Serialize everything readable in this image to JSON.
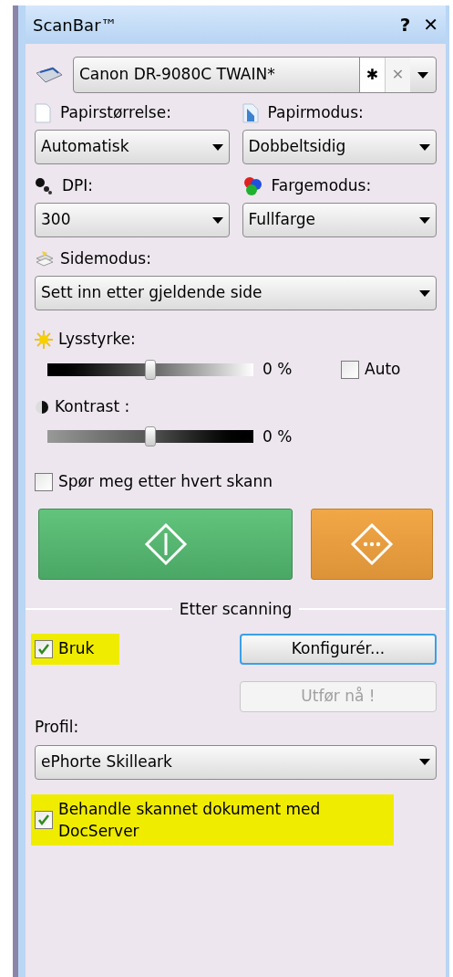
{
  "window": {
    "title": "ScanBar™",
    "help": "?",
    "close": "✕"
  },
  "scanner": {
    "value": "Canon DR-9080C TWAIN*",
    "star": "✱",
    "clear": "✕",
    "clear_disabled": true
  },
  "fields": [
    {
      "label": "Papirstørrelse:",
      "value": "Automatisk"
    },
    {
      "label": "Papirmodus:",
      "value": "Dobbeltsidig"
    },
    {
      "label": "DPI:",
      "value": "300"
    },
    {
      "label": "Fargemodus:",
      "value": "Fullfarge"
    }
  ],
  "side_mode": {
    "label": "Sidemodus:",
    "value": "Sett inn etter gjeldende side"
  },
  "sliders": [
    {
      "kind": "brightness",
      "label": "Lysstyrke:",
      "level": 0.5,
      "reading": "0 %"
    },
    {
      "kind": "contrast",
      "label": "Kontrast :",
      "level": 0.5,
      "reading": "0 %"
    }
  ],
  "auto": {
    "label": "Auto",
    "checked": false
  },
  "ask_each_scan": {
    "label": "Spør meg etter hvert skann",
    "checked": false
  },
  "after_scanning": {
    "title": "Etter scanning",
    "use": {
      "label": "Bruk",
      "checked": true,
      "highlighted": true
    },
    "configure": "Konfigurér...",
    "run_now": {
      "label": "Utfør nå !",
      "disabled": true
    },
    "profile": {
      "label": "Profil:",
      "value": "ePhorte Skilleark"
    },
    "docserver": {
      "label": "Behandle skannet dokument med DocServer",
      "checked": true,
      "highlighted": true
    }
  }
}
